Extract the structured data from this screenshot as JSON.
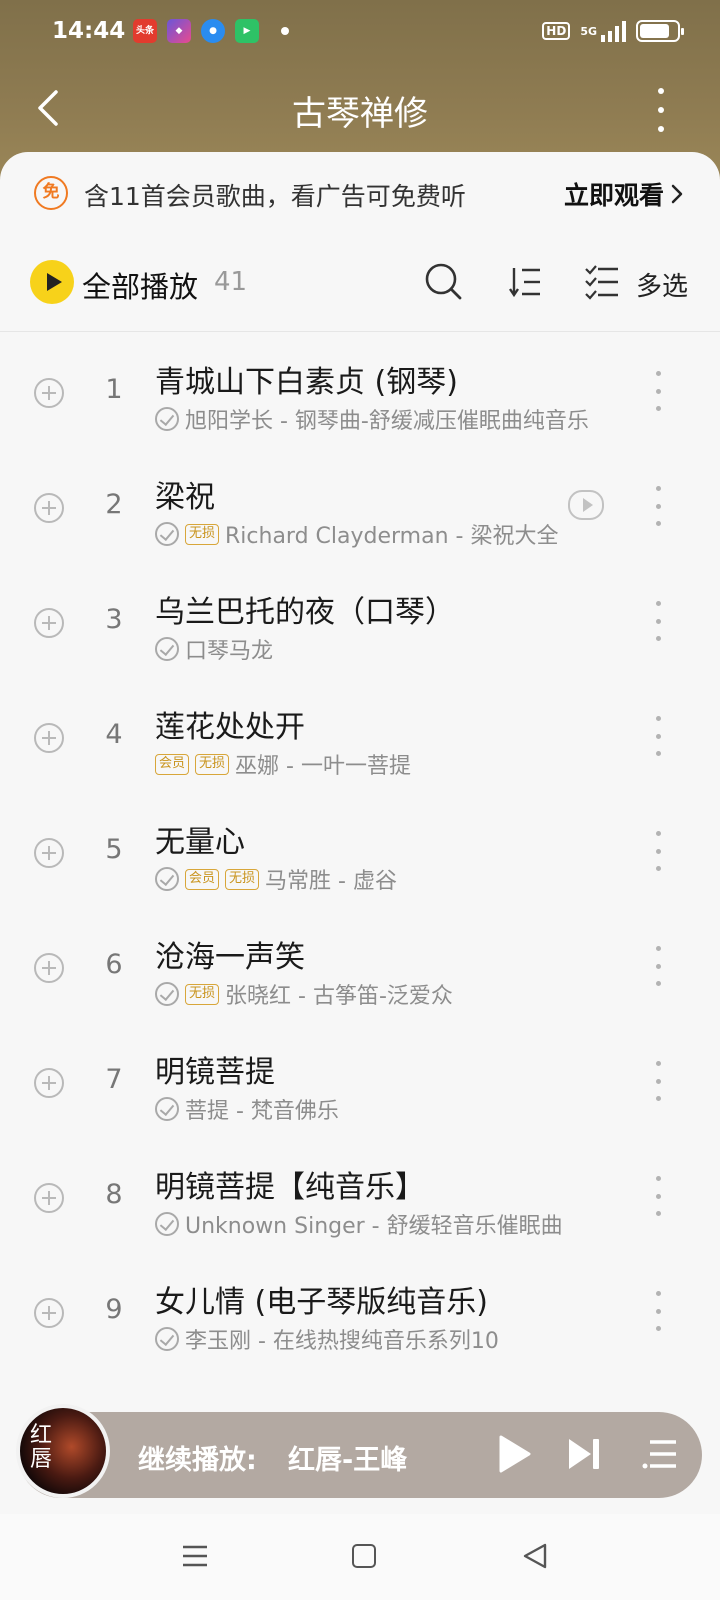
{
  "status_bar": {
    "time": "14:44",
    "notification_icons": [
      "头条",
      "app-icon",
      "browser-icon",
      "video-icon"
    ],
    "hd_label": "HD",
    "network_label": "5G",
    "battery_percent": 80
  },
  "nav": {
    "title": "古琴禅修"
  },
  "promo": {
    "icon_label": "免",
    "text": "含11首会员歌曲，看广告可免费听",
    "action_label": "立即观看"
  },
  "toolbar": {
    "play_all_label": "全部播放",
    "play_all_count": "41",
    "multi_select_label": "多选"
  },
  "songs": [
    {
      "index": "1",
      "title": "青城山下白素贞 (钢琴)",
      "downloaded": true,
      "tags": [],
      "subtitle": "旭阳学长 - 钢琴曲-舒缓减压催眠曲纯音乐",
      "has_mv": false
    },
    {
      "index": "2",
      "title": "梁祝",
      "downloaded": true,
      "tags": [
        "无损"
      ],
      "subtitle": "Richard Clayderman - 梁祝大全",
      "has_mv": true
    },
    {
      "index": "3",
      "title": "乌兰巴托的夜（口琴）",
      "downloaded": true,
      "tags": [],
      "subtitle": "口琴马龙",
      "has_mv": false
    },
    {
      "index": "4",
      "title": "莲花处处开",
      "downloaded": false,
      "tags": [
        "会员",
        "无损"
      ],
      "subtitle": "巫娜 - 一叶一菩提",
      "has_mv": false
    },
    {
      "index": "5",
      "title": "无量心",
      "downloaded": true,
      "tags": [
        "会员",
        "无损"
      ],
      "subtitle": "马常胜 - 虚谷",
      "has_mv": false
    },
    {
      "index": "6",
      "title": "沧海一声笑",
      "downloaded": true,
      "tags": [
        "无损"
      ],
      "subtitle": "张晓红 - 古筝笛-泛爱众",
      "has_mv": false
    },
    {
      "index": "7",
      "title": "明镜菩提",
      "downloaded": true,
      "tags": [],
      "subtitle": "菩提 - 梵音佛乐",
      "has_mv": false
    },
    {
      "index": "8",
      "title": "明镜菩提【纯音乐】",
      "downloaded": true,
      "tags": [],
      "subtitle": "Unknown Singer - 舒缓轻音乐催眠曲",
      "has_mv": false
    },
    {
      "index": "9",
      "title": "女儿情 (电子琴版纯音乐)",
      "downloaded": true,
      "tags": [],
      "subtitle": "李玉刚 - 在线热搜纯音乐系列10",
      "has_mv": false
    }
  ],
  "player": {
    "album_art_text": "红唇",
    "label": "继续播放:",
    "song": "红唇-王峰"
  },
  "colors": {
    "header_brown": "#8f7c52",
    "play_all_yellow": "#f7d21a",
    "promo_orange": "#f07a22",
    "tag_gold": "#c9941e"
  }
}
